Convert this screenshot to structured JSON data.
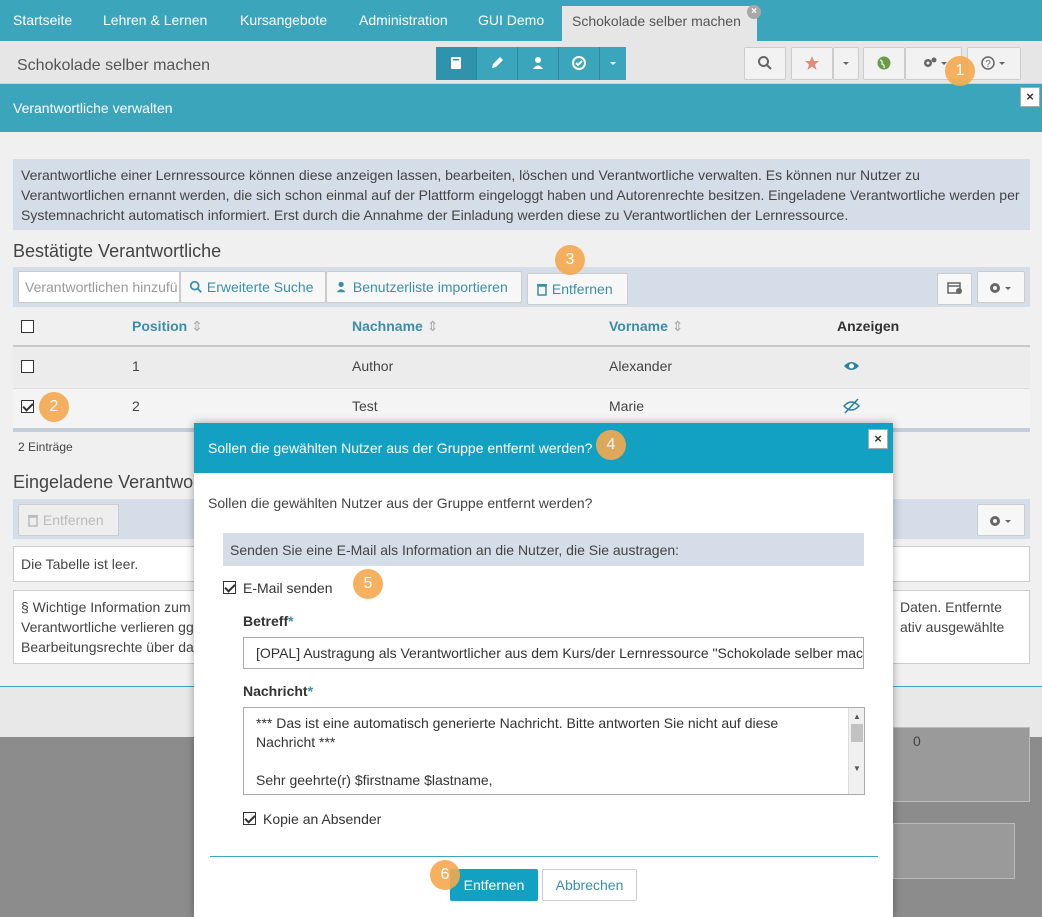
{
  "nav": {
    "tabs": [
      "Startseite",
      "Lehren & Lernen",
      "Kursangebote",
      "Administration",
      "GUI Demo"
    ],
    "active_tab": "Schokolade selber machen"
  },
  "titlebar": {
    "title": "Schokolade selber machen"
  },
  "panel": {
    "title": "Verantwortliche verwalten"
  },
  "info": {
    "text": "Verantwortliche einer Lernressource können diese anzeigen lassen, bearbeiten, löschen und Verantwortliche verwalten. Es können nur Nutzer zu Verantwortlichen ernannt werden, die sich schon einmal auf der Plattform eingeloggt haben und Autorenrechte besitzen. Eingeladene Verantwortliche werden per Systemnachricht automatisch informiert. Erst durch die Annahme der Einladung werden diese zu Verantwortlichen der Lernressource."
  },
  "confirmed": {
    "heading": "Bestätigte Verantwortliche",
    "add_placeholder": "Verantwortlichen hinzufü",
    "advanced_search": "Erweiterte Suche",
    "import_list": "Benutzerliste importieren",
    "remove": "Entfernen",
    "columns": {
      "position": "Position",
      "lastname": "Nachname",
      "firstname": "Vorname",
      "show": "Anzeigen"
    },
    "rows": [
      {
        "position": "1",
        "lastname": "Author",
        "firstname": "Alexander"
      },
      {
        "position": "2",
        "lastname": "Test",
        "firstname": "Marie"
      }
    ],
    "count": "2 Einträge"
  },
  "invited": {
    "heading": "Eingeladene Verantwortliche",
    "remove": "Entfernen",
    "empty": "Die Tabelle ist leer.",
    "note_left_1": "§ Wichtige Information zum",
    "note_left_2": "Verantwortliche verlieren gg",
    "note_left_3": "Bearbeitungsrechte über da",
    "note_right_1": "Daten. Entfernte",
    "note_right_2": "ativ ausgewählte",
    "bg_zero": "0"
  },
  "modal": {
    "title": "Sollen die gewählten Nutzer aus der Gruppe entfernt werden?",
    "question": "Sollen die gewählten Nutzer aus der Gruppe entfernt werden?",
    "hint": "Senden Sie eine E-Mail als Information an die Nutzer, die Sie austragen:",
    "send_mail": "E-Mail senden",
    "subject_label": "Betreff",
    "subject_value": "[OPAL] Austragung als Verantwortlicher aus dem Kurs/der Lernressource \"Schokolade selber machen\"",
    "message_label": "Nachricht",
    "message_line1": "*** Das ist eine automatisch generierte Nachricht. Bitte antworten Sie nicht auf diese",
    "message_line2": "Nachricht ***",
    "message_line3": "Sehr geehrte(r) $firstname $lastname,",
    "copy_sender": "Kopie an Absender",
    "confirm": "Entfernen",
    "cancel": "Abbrechen",
    "required_mark": "*"
  },
  "badges": [
    "1",
    "2",
    "3",
    "4",
    "5",
    "6"
  ]
}
